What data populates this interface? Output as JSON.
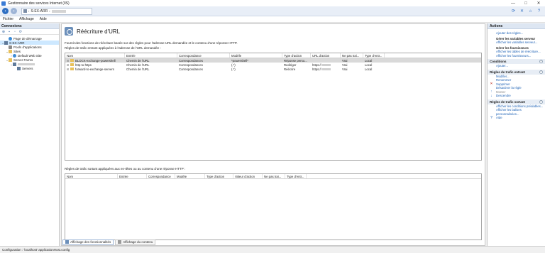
{
  "window": {
    "title": "Gestionnaire des services Internet (IIS)",
    "controls": [
      "—",
      "□",
      "✕"
    ]
  },
  "address": {
    "server": "S-EX-ARR"
  },
  "menu": [
    "Fichier",
    "Affichage",
    "Aide"
  ],
  "connections": {
    "header": "Connexions",
    "tree": [
      {
        "label": "Page de démarrage",
        "icon": "globe-icon",
        "indent": 1,
        "twisty": ""
      },
      {
        "label": "S-EX-ARR",
        "icon": "server-icon",
        "indent": 0,
        "twisty": "⌄",
        "selected": true
      },
      {
        "label": "Pools d'applications",
        "icon": "gear-icon",
        "indent": 1,
        "twisty": ""
      },
      {
        "label": "Sites",
        "icon": "folder-icon",
        "indent": 1,
        "twisty": "⌄"
      },
      {
        "label": "Default Web Site",
        "icon": "globe-icon",
        "indent": 2,
        "twisty": "›"
      },
      {
        "label": "Server Farms",
        "icon": "folder-icon",
        "indent": 1,
        "twisty": "⌄"
      },
      {
        "label": "",
        "icon": "server-icon",
        "indent": 2,
        "twisty": "⌄",
        "blurred": true
      },
      {
        "label": "Servers",
        "icon": "server-icon",
        "indent": 3,
        "twisty": ""
      }
    ]
  },
  "feature": {
    "title": "Réécriture d'URL",
    "description": "Fournit des fonctions de réécriture basée sur des règles pour l'adresse URL demandée et le contenu d'une réponse HTTP.",
    "inbound_label": "Règles de trafic entrant appliquées à l'adresse de l'URL demandée :",
    "inbound_columns": [
      "Nom",
      "Entrée",
      "Correspondance",
      "Modèle",
      "Type d'action",
      "URL d'action",
      "Ne pas trai...",
      "Type d'entr..."
    ],
    "inbound_rows": [
      [
        "BLOCK-exchange-powershell",
        "Chemin de l'URL",
        "Correspondances",
        "*powershell*",
        "Réponse perso...",
        "",
        "Vrai",
        "Local"
      ],
      [
        "http-to-https",
        "Chemin de l'URL",
        "Correspondances",
        "(.*)",
        "Rediriger",
        "https://",
        "Vrai",
        "Local"
      ],
      [
        "forward-to-exchange-servers",
        "Chemin de l'URL",
        "Correspondances",
        "(.*)",
        "Réécrire",
        "https://",
        "Vrai",
        "Local"
      ]
    ],
    "outbound_label": "Règles de trafic sortant appliquées aux en-têtes ou au contenu d'une réponse HTTP :",
    "outbound_columns": [
      "Nom",
      "Entrée",
      "Correspondance",
      "Modèle",
      "Type d'action",
      "Valeur d'action",
      "Ne pas trai...",
      "Type d'entr..."
    ]
  },
  "tabs": [
    "Affichage des fonctionnalités",
    "Affichage du contenu"
  ],
  "actions": {
    "header": "Actions",
    "groups": [
      {
        "title": "",
        "items": [
          {
            "label": "Ajouter des règles...",
            "style": "link",
            "icon": ""
          },
          {
            "label": "Gérer les variables serveur",
            "style": "bold",
            "icon": ""
          },
          {
            "label": "Afficher les variables serveur...",
            "style": "link",
            "icon": ""
          },
          {
            "label": "Gérer les fournisseurs",
            "style": "bold",
            "icon": ""
          },
          {
            "label": "Afficher les tables de réécriture...",
            "style": "link",
            "icon": ""
          },
          {
            "label": "Afficher les fournisseurs...",
            "style": "link",
            "icon": ""
          }
        ]
      },
      {
        "title": "Conditions",
        "items": [
          {
            "label": "Ajouter...",
            "style": "link",
            "icon": ""
          }
        ]
      },
      {
        "title": "Règles de trafic entrant",
        "items": [
          {
            "label": "Modifier...",
            "style": "link",
            "icon": ""
          },
          {
            "label": "Renommer",
            "style": "link",
            "icon": ""
          },
          {
            "label": "Supprimer",
            "style": "link",
            "icon": "✕"
          },
          {
            "label": "Désactiver la règle",
            "style": "link",
            "icon": ""
          },
          {
            "label": "Monter",
            "style": "dis",
            "icon": "↑"
          },
          {
            "label": "Descendre",
            "style": "link",
            "icon": "↓"
          }
        ]
      },
      {
        "title": "Règles de trafic sortant",
        "items": [
          {
            "label": "Afficher les conditions préalables...",
            "style": "link",
            "icon": ""
          },
          {
            "label": "Afficher les balises personnalisées...",
            "style": "link",
            "icon": ""
          },
          {
            "label": "Aide",
            "style": "link",
            "icon": "?"
          }
        ]
      }
    ]
  },
  "status": "Configuration : 'localhost' applicationHost.config",
  "colors": {
    "accent": "#1a5fb4",
    "selection": "#cde8ff",
    "header_bg": "#dde6f2"
  }
}
